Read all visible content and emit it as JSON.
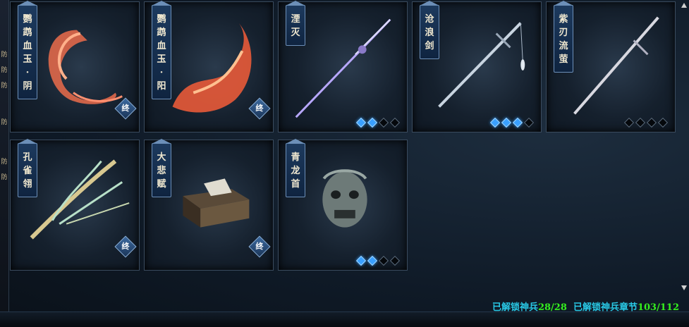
{
  "sidebar_glyphs": [
    "防",
    "防",
    "防",
    "防",
    "防",
    "防"
  ],
  "cards": [
    {
      "name_chars": [
        "鹦",
        "鹉",
        "血",
        "玉",
        "·",
        "阴"
      ],
      "badge": "终",
      "stars": null
    },
    {
      "name_chars": [
        "鹦",
        "鹉",
        "血",
        "玉",
        "·",
        "阳"
      ],
      "badge": "终",
      "stars": null
    },
    {
      "name_chars": [
        "湮",
        "灭"
      ],
      "badge": null,
      "stars": [
        true,
        true,
        false,
        false
      ]
    },
    {
      "name_chars": [
        "沧",
        "浪",
        "剑"
      ],
      "badge": null,
      "stars": [
        true,
        true,
        true,
        false
      ]
    },
    {
      "name_chars": [
        "紫",
        "刃",
        "流",
        "萤"
      ],
      "badge": null,
      "stars": [
        false,
        false,
        false,
        false
      ]
    },
    {
      "name_chars": [
        "孔",
        "雀",
        "翎"
      ],
      "badge": "终",
      "stars": null
    },
    {
      "name_chars": [
        "大",
        "悲",
        "赋"
      ],
      "badge": "终",
      "stars": null
    },
    {
      "name_chars": [
        "青",
        "龙",
        "首"
      ],
      "badge": null,
      "stars": [
        true,
        true,
        false,
        false
      ]
    }
  ],
  "footer": {
    "label1": "已解锁神兵",
    "value1": "28/28",
    "label2": "已解锁神兵章节",
    "value2": "103/112"
  },
  "colors": {
    "label": "#29c9e6",
    "value": "#35f01e",
    "star_on": "#3aa0ff"
  }
}
